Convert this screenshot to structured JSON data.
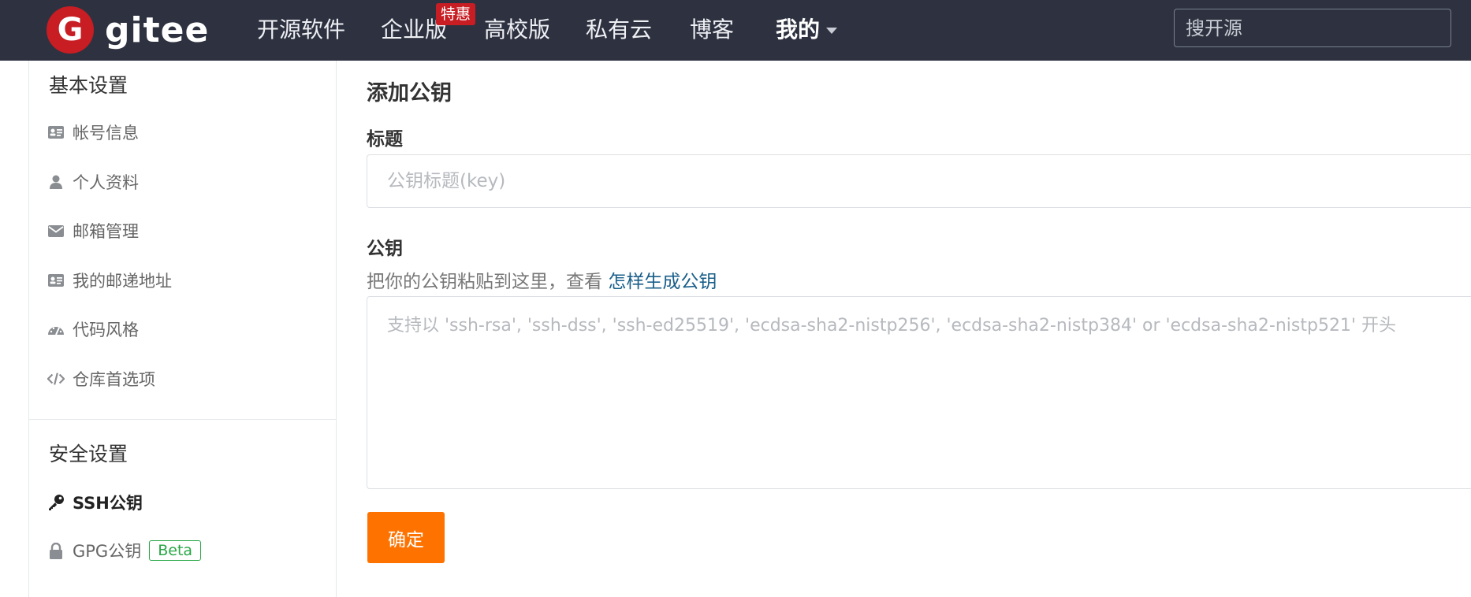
{
  "header": {
    "logo_mark": "G",
    "logo_text": "gitee",
    "nav": [
      "开源软件",
      "企业版",
      "高校版",
      "私有云",
      "博客",
      "我的"
    ],
    "promo_badge": "特惠",
    "search_placeholder": "搜开源"
  },
  "sidebar": {
    "basic_heading": "基本设置",
    "basic_items": [
      {
        "label": "帐号信息",
        "icon": "id-card-icon"
      },
      {
        "label": "个人资料",
        "icon": "user-icon"
      },
      {
        "label": "邮箱管理",
        "icon": "envelope-icon"
      },
      {
        "label": "我的邮递地址",
        "icon": "address-card-icon"
      },
      {
        "label": "代码风格",
        "icon": "dashboard-icon"
      },
      {
        "label": "仓库首选项",
        "icon": "code-icon"
      }
    ],
    "security_heading": "安全设置",
    "security_items": [
      {
        "label": "SSH公钥",
        "icon": "key-icon",
        "active": true
      },
      {
        "label": "GPG公钥",
        "icon": "lock-icon",
        "badge": "Beta"
      }
    ]
  },
  "main": {
    "title": "添加公钥",
    "title_label": "标题",
    "title_placeholder": "公钥标题(key)",
    "key_label": "公钥",
    "help_text": "把你的公钥粘贴到这里，查看 ",
    "help_link": "怎样生成公钥",
    "key_placeholder": "支持以 'ssh-rsa', 'ssh-dss', 'ssh-ed25519', 'ecdsa-sha2-nistp256', 'ecdsa-sha2-nistp384' or 'ecdsa-sha2-nistp521' 开头",
    "submit_label": "确定"
  },
  "colors": {
    "nav_bg": "#2e3240",
    "brand_red": "#c71d23",
    "submit_orange": "#fe7300",
    "link_blue": "#1a5f8a",
    "beta_green": "#28a745"
  }
}
